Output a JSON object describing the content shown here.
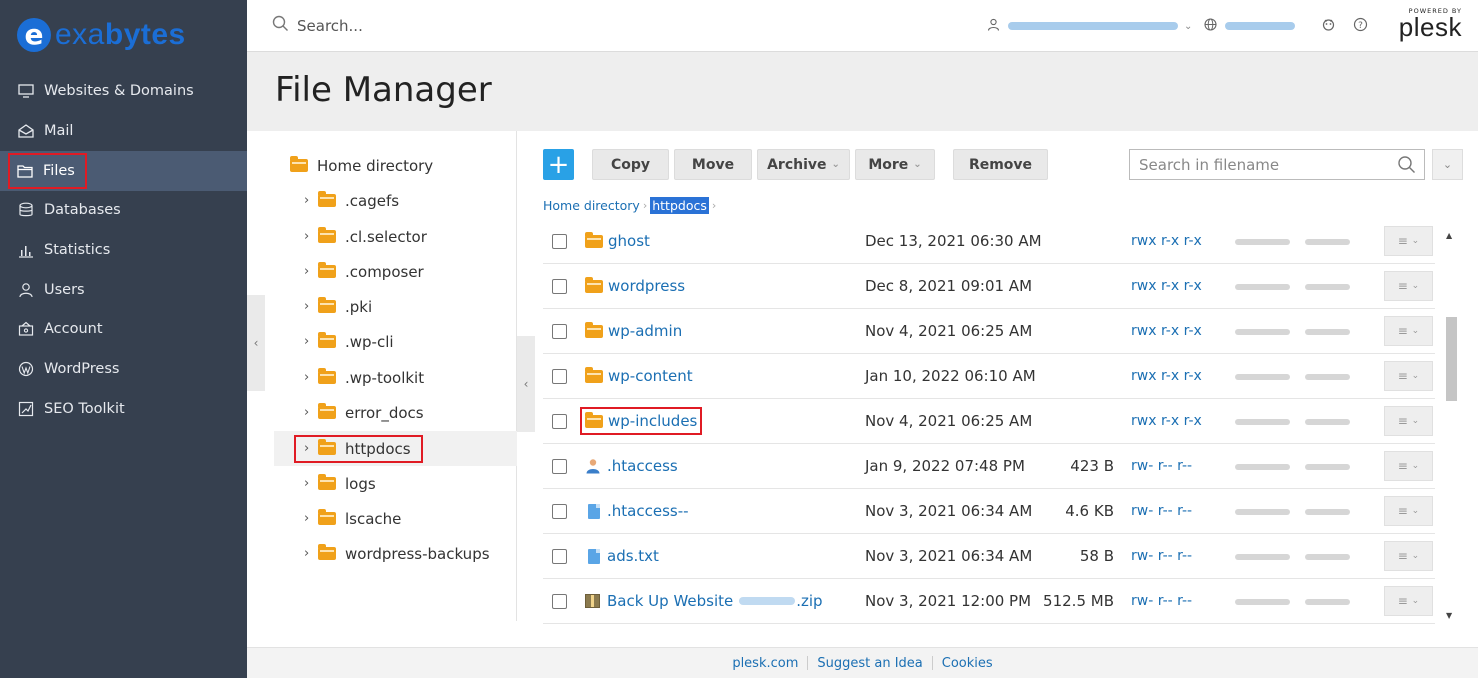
{
  "brand": {
    "logo_letter": "e",
    "logo_text_a": "exa",
    "logo_text_b": "bytes"
  },
  "sidebar": {
    "items": [
      {
        "label": "Websites & Domains",
        "icon": "monitor-icon"
      },
      {
        "label": "Mail",
        "icon": "mail-icon"
      },
      {
        "label": "Files",
        "icon": "folder-icon",
        "active": true
      },
      {
        "label": "Databases",
        "icon": "database-icon"
      },
      {
        "label": "Statistics",
        "icon": "bar-chart-icon"
      },
      {
        "label": "Users",
        "icon": "user-icon"
      },
      {
        "label": "Account",
        "icon": "account-icon"
      },
      {
        "label": "WordPress",
        "icon": "wordpress-icon"
      },
      {
        "label": "SEO Toolkit",
        "icon": "seo-icon"
      }
    ]
  },
  "topbar": {
    "search_placeholder": "Search...",
    "powered_by": "POWERED BY",
    "product": "plesk"
  },
  "page": {
    "title": "File Manager"
  },
  "tree": {
    "root": "Home directory",
    "items": [
      ".cagefs",
      ".cl.selector",
      ".composer",
      ".pki",
      ".wp-cli",
      ".wp-toolkit",
      "error_docs",
      "httpdocs",
      "logs",
      "lscache",
      "wordpress-backups"
    ],
    "selected": "httpdocs"
  },
  "toolbar": {
    "add_label": "+",
    "copy": "Copy",
    "move": "Move",
    "archive": "Archive",
    "more": "More",
    "remove": "Remove",
    "search_placeholder": "Search in filename"
  },
  "breadcrumb": {
    "root": "Home directory",
    "current": "httpdocs"
  },
  "files": [
    {
      "name": "ghost",
      "type": "folder",
      "date": "Dec 13, 2021 06:30 AM",
      "size": "",
      "perm": "rwx r-x r-x"
    },
    {
      "name": "wordpress",
      "type": "folder",
      "date": "Dec 8, 2021 09:01 AM",
      "size": "",
      "perm": "rwx r-x r-x"
    },
    {
      "name": "wp-admin",
      "type": "folder",
      "date": "Nov 4, 2021 06:25 AM",
      "size": "",
      "perm": "rwx r-x r-x"
    },
    {
      "name": "wp-content",
      "type": "folder",
      "date": "Jan 10, 2022 06:10 AM",
      "size": "",
      "perm": "rwx r-x r-x"
    },
    {
      "name": "wp-includes",
      "type": "folder",
      "date": "Nov 4, 2021 06:25 AM",
      "size": "",
      "perm": "rwx r-x r-x",
      "highlight": true
    },
    {
      "name": ".htaccess",
      "type": "user",
      "date": "Jan 9, 2022 07:48 PM",
      "size": "423 B",
      "perm": "rw- r-- r--"
    },
    {
      "name": ".htaccess--",
      "type": "file",
      "date": "Nov 3, 2021 06:34 AM",
      "size": "4.6 KB",
      "perm": "rw- r-- r--"
    },
    {
      "name": "ads.txt",
      "type": "file",
      "date": "Nov 3, 2021 06:34 AM",
      "size": "58 B",
      "perm": "rw- r-- r--"
    },
    {
      "name": "Back Up Website",
      "suffix": ".zip",
      "type": "zip",
      "date": "Nov 3, 2021 12:00 PM",
      "size": "512.5 MB",
      "perm": "rw- r-- r--"
    }
  ],
  "footer": {
    "link1": "plesk.com",
    "link2": "Suggest an Idea",
    "link3": "Cookies"
  },
  "colors": {
    "sidebar": "#36404f",
    "accent": "#1b6ed6",
    "highlight": "#e01b24",
    "link": "#1b6fb3"
  }
}
